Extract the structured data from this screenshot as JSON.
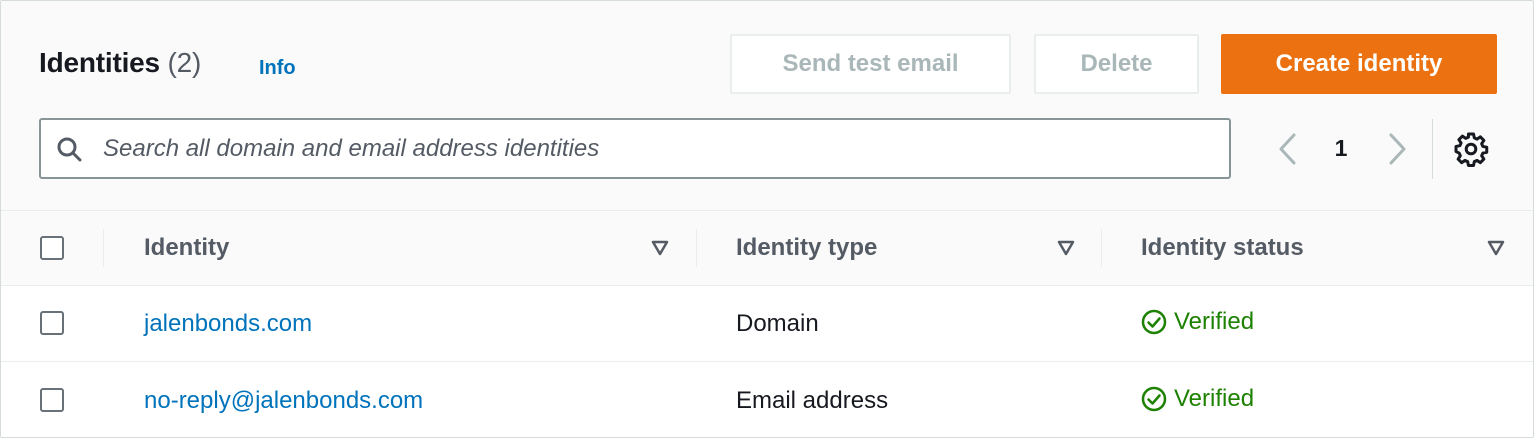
{
  "header": {
    "title": "Identities",
    "count": "(2)",
    "info_link": "Info"
  },
  "actions": {
    "send_test_email": "Send test email",
    "delete": "Delete",
    "create_identity": "Create identity"
  },
  "search": {
    "placeholder": "Search all domain and email address identities",
    "value": "",
    "icon": "search-icon"
  },
  "pagination": {
    "current_page": "1",
    "prev_icon": "chevron-left-icon",
    "next_icon": "chevron-right-icon",
    "settings_icon": "gear-icon"
  },
  "table": {
    "columns": [
      "Identity",
      "Identity type",
      "Identity status"
    ],
    "rows": [
      {
        "identity": "jalenbonds.com",
        "type": "Domain",
        "status": "Verified"
      },
      {
        "identity": "no-reply@jalenbonds.com",
        "type": "Email address",
        "status": "Verified"
      }
    ]
  },
  "colors": {
    "primary_button": "#ec7211",
    "link": "#0073bb",
    "status_success": "#1d8102",
    "disabled_text": "#aab7b8"
  }
}
